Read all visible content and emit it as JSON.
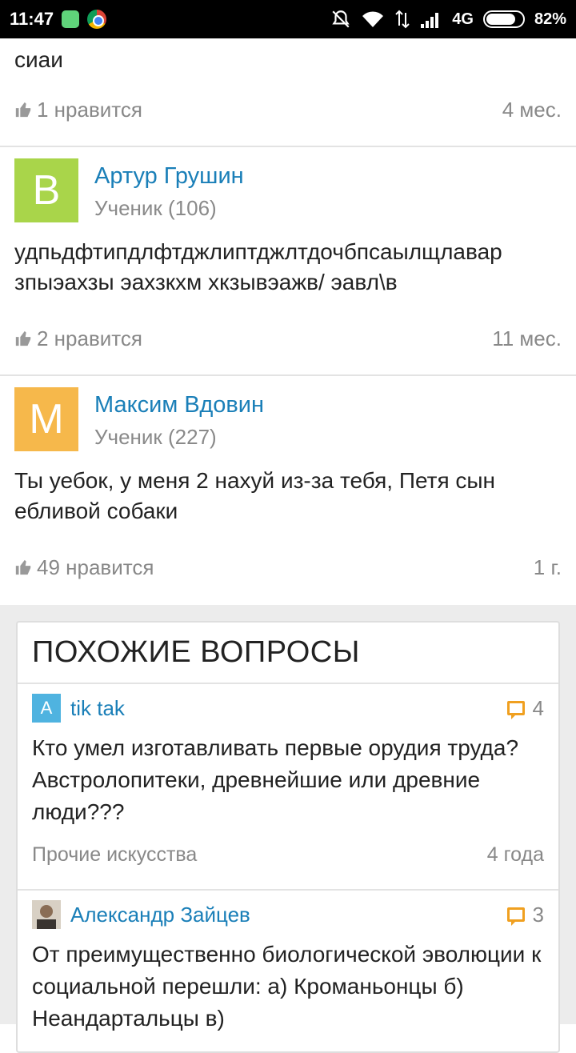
{
  "status_bar": {
    "time": "11:47",
    "network": "4G",
    "battery": "82%",
    "battery_level": 0.82
  },
  "answers": [
    {
      "text_lines": [
        "сиаи"
      ],
      "likes": "1 нравится",
      "time": "4 мес."
    },
    {
      "avatar_letter": "B",
      "avatar_color": "#a9d54a",
      "author": "Артур Грушин",
      "rank": "Ученик (106)",
      "text_lines": [
        "удпьдфтипдлфтджлиптджлтдочбпсаылщлавар",
        "зпыэахзы эахзкхм хкзывэажв/ эавл\\в"
      ],
      "likes": "2 нравится",
      "time": "11 мес."
    },
    {
      "avatar_letter": "M",
      "avatar_color": "#f6b84b",
      "author": "Максим Вдовин",
      "rank": "Ученик (227)",
      "text_lines": [
        "Ты уебок, у меня 2 нахуй из-за тебя, Петя сын",
        "ебливой собаки"
      ],
      "likes": "49 нравится",
      "time": "1 г."
    }
  ],
  "similar": {
    "title": "ПОХОЖИЕ ВОПРОСЫ",
    "items": [
      {
        "avatar_letter": "A",
        "avatar_color": "#4fb3e0",
        "author": "tik tak",
        "count": "4",
        "text": "Кто умел изготавливать первые орудия труда? Австролопитеки, древнейшие или древние люди???",
        "category": "Прочие искусства",
        "time": "4 года"
      },
      {
        "avatar_letter": "",
        "avatar_color": "#6b5a48",
        "author": "Александр Зайцев",
        "count": "3",
        "text": "От преимущественно биологической эволюции к социальной перешли: а) Кроманьонцы б) Неандартальцы в)",
        "category": "",
        "time": ""
      }
    ]
  }
}
